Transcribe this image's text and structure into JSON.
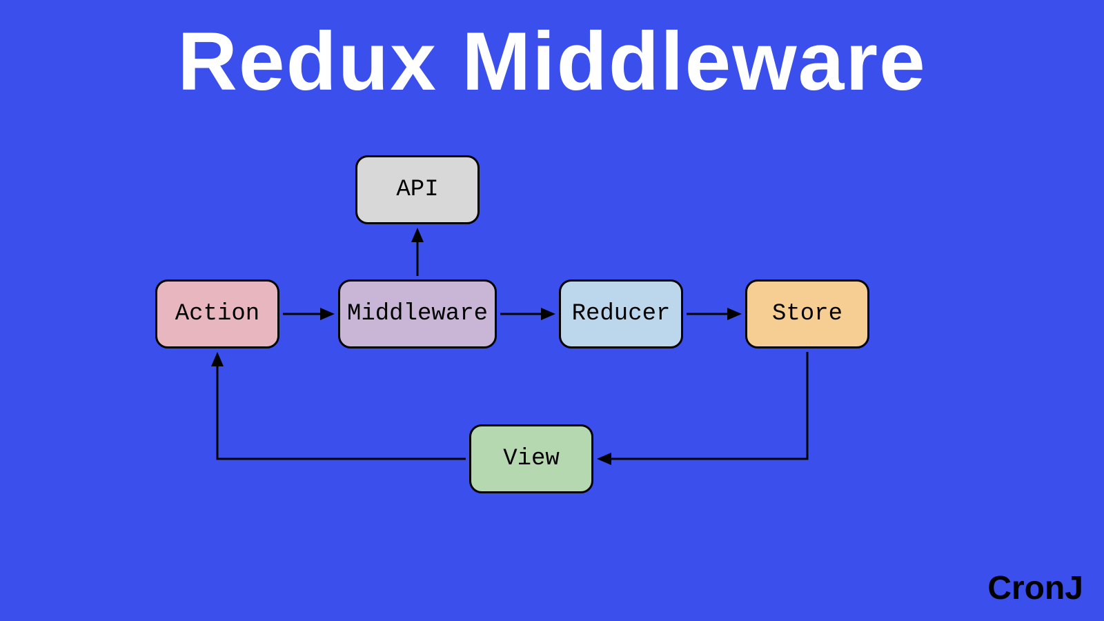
{
  "title": "Redux Middleware",
  "nodes": {
    "action": "Action",
    "middleware": "Middleware",
    "reducer": "Reducer",
    "store": "Store",
    "api": "API",
    "view": "View"
  },
  "edges": [
    {
      "from": "action",
      "to": "middleware"
    },
    {
      "from": "middleware",
      "to": "reducer"
    },
    {
      "from": "reducer",
      "to": "store"
    },
    {
      "from": "middleware",
      "to": "api"
    },
    {
      "from": "store",
      "to": "view"
    },
    {
      "from": "view",
      "to": "action"
    }
  ],
  "watermark": "CronJ"
}
